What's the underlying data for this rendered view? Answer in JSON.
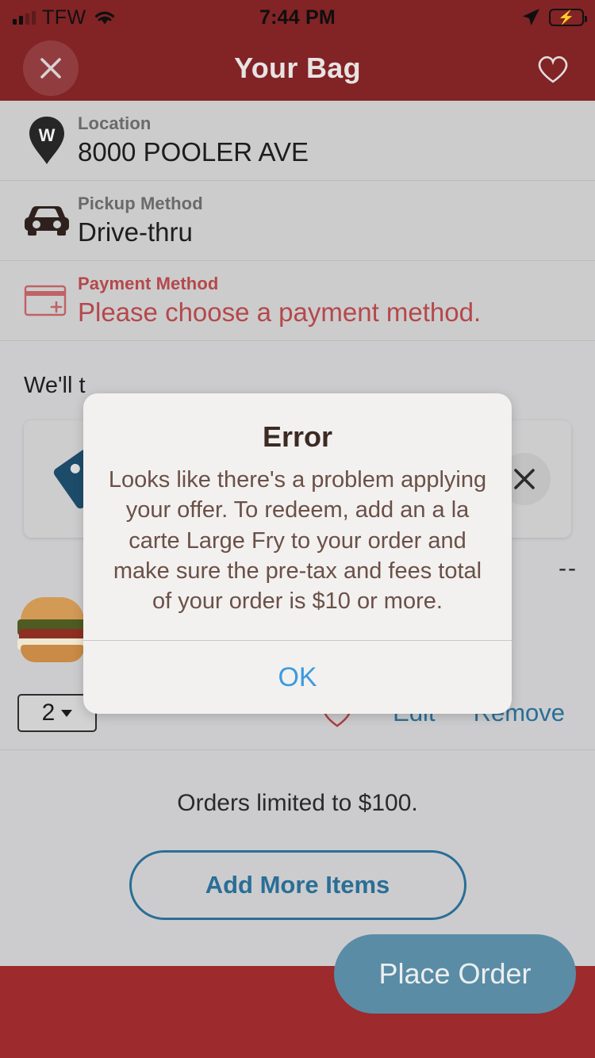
{
  "status_bar": {
    "carrier": "TFW",
    "time": "7:44 PM",
    "signal_icon": "signal-bars-icon",
    "wifi_icon": "wifi-icon",
    "location_icon": "location-arrow-icon",
    "battery_icon": "battery-charging-icon"
  },
  "header": {
    "title": "Your Bag",
    "close_icon": "close-icon",
    "favorite_icon": "heart-outline-icon",
    "background_color": "#822325"
  },
  "info_rows": [
    {
      "label": "Location",
      "value": "8000 POOLER AVE",
      "icon": "map-pin-w-icon",
      "color": "#1d1d1d"
    },
    {
      "label": "Pickup Method",
      "value": "Drive-thru",
      "icon": "car-icon",
      "color": "#1d1d1d"
    },
    {
      "label": "Payment Method",
      "value": "Please choose a payment method.",
      "icon": "add-credit-card-icon",
      "color": "#b5484a"
    }
  ],
  "content": {
    "promo_note": "We'll t",
    "offer_card": {
      "tag_icon": "price-tag-icon",
      "remove_icon": "close-icon"
    },
    "item": {
      "image": "sandwich-thumbnail",
      "price": "--",
      "quantity": "2",
      "favorite_icon": "heart-outline-icon",
      "edit_label": "Edit",
      "remove_label": "Remove"
    },
    "limit_note": "Orders limited to $100.",
    "add_more_label": "Add More Items"
  },
  "bottom": {
    "place_order_label": "Place Order",
    "bar_color": "#9d2a2c",
    "button_color": "#5a8ca6"
  },
  "dialog": {
    "title": "Error",
    "message": "Looks like there's a problem applying your offer. To redeem, add an a la carte Large Fry to your order and make sure the pre-tax and fees total of your order is $10 or more.",
    "ok_label": "OK",
    "ok_color": "#3d9ae0"
  }
}
